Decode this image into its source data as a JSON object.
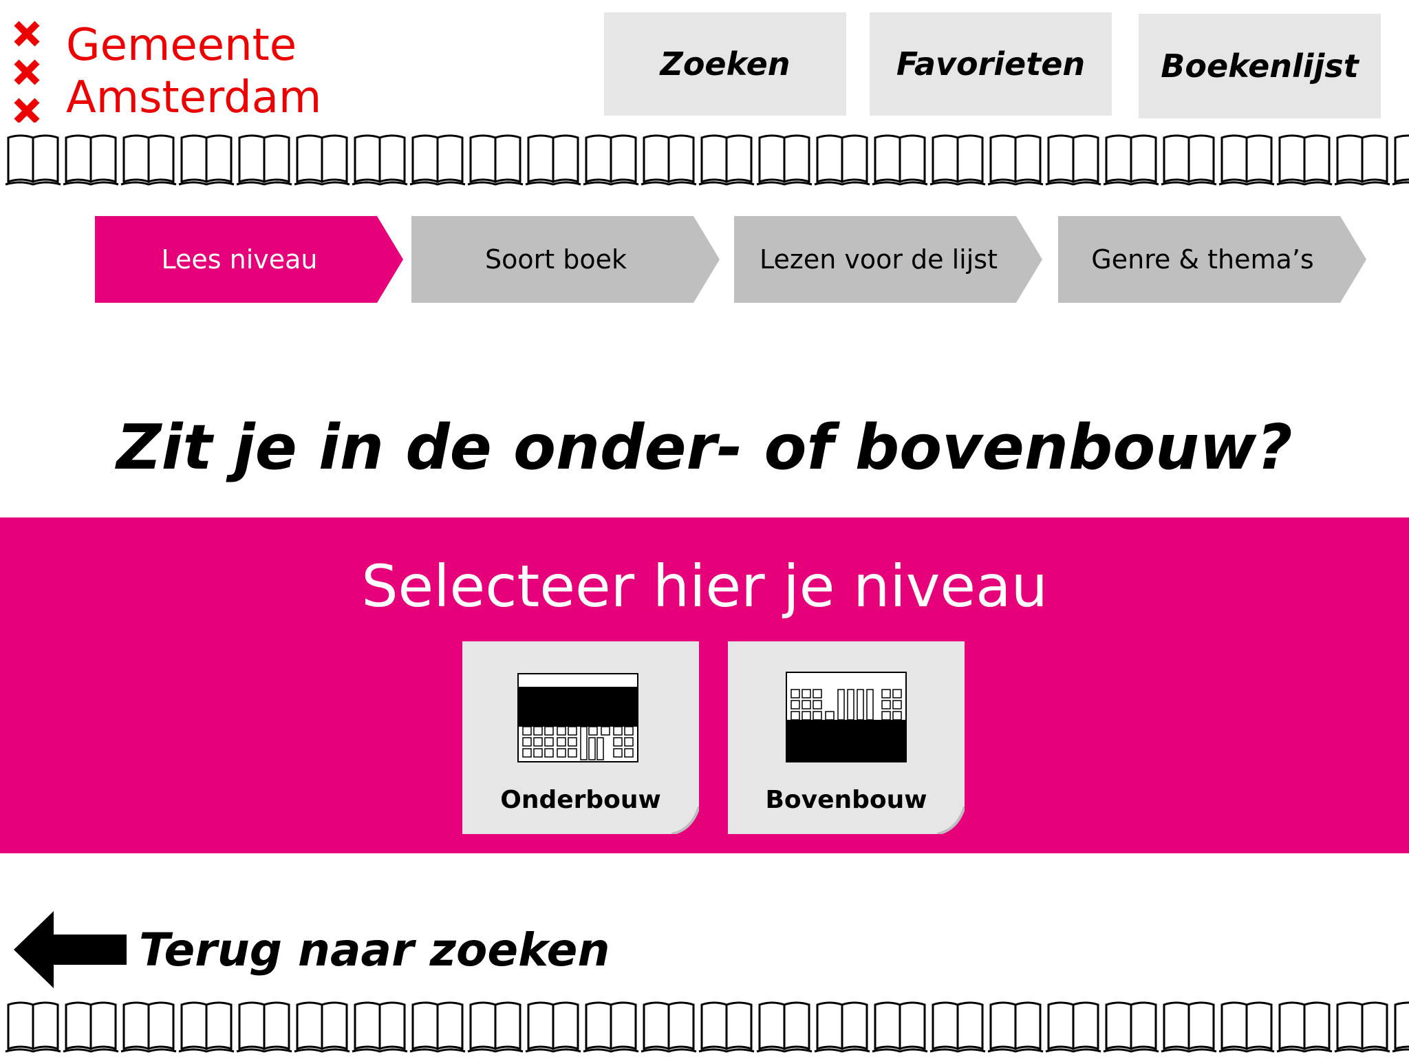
{
  "brand": {
    "name_line1": "Gemeente",
    "name_line2": "Amsterdam",
    "crosses_icon": "xxx-crosses-icon",
    "color": "#ec0000"
  },
  "top_nav": {
    "search_label": "Zoeken",
    "favorites_label": "Favorieten",
    "booklist_label": "Boekenlijst"
  },
  "decoration": {
    "border_icon": "open-book-icon"
  },
  "steps": [
    {
      "label": "Lees niveau",
      "active": true
    },
    {
      "label": "Soort boek",
      "active": false
    },
    {
      "label": "Lezen voor de lijst",
      "active": false
    },
    {
      "label": "Genre & thema’s",
      "active": false
    }
  ],
  "main": {
    "question": "Zit je in de onder- of bovenbouw?",
    "select_title": "Selecteer hier je niveau",
    "options": [
      {
        "label": "Onderbouw",
        "icon": "lower-building-icon"
      },
      {
        "label": "Bovenbouw",
        "icon": "upper-building-icon"
      }
    ]
  },
  "footer": {
    "back_label": "Terug naar zoeken",
    "back_icon": "arrow-left-icon"
  },
  "colors": {
    "accent_pink": "#e6007a",
    "button_gray": "#e6e6e6",
    "step_gray": "#bfbfbf",
    "logo_red": "#ec0000"
  }
}
